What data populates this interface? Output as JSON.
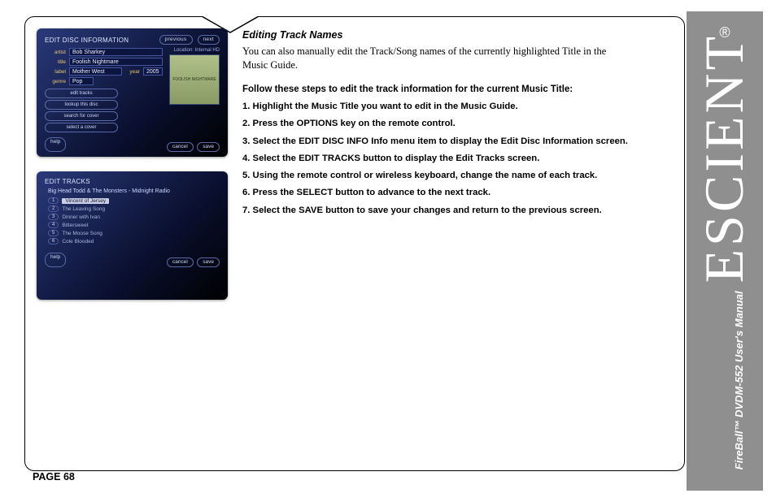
{
  "page": {
    "number_label": "PAGE 68"
  },
  "sidebar": {
    "brand": "ESCIENT",
    "registered": "®",
    "subline_product": "FireBall™",
    "subline_model": "DVDM-552 User's Manual"
  },
  "section": {
    "title": "Editing Track Names",
    "intro": "You can also manually edit the Track/Song names of the currently highlighted Title in the Music Guide.",
    "steps_lead": "Follow these steps to edit the track information for the current Music Title:",
    "steps": [
      "Highlight the Music Title you want to edit in the Music Guide.",
      "Press the OPTIONS key on the remote control.",
      "Select the EDIT DISC INFO Info menu item to display the Edit Disc Information screen.",
      "Select the EDIT TRACKS button to display the Edit Tracks screen.",
      "Using the remote control or wireless keyboard, change the name of each track.",
      "Press the SELECT button to advance to the next track.",
      "Select the SAVE button to save your changes and return to the previous screen."
    ]
  },
  "thumb1": {
    "header": "EDIT DISC INFORMATION",
    "nav_prev": "previous",
    "nav_next": "next",
    "fields": {
      "artist_label": "artist",
      "artist_value": "Bob Sharkey",
      "title_label": "title",
      "title_value": "Foolish Nightmare",
      "label_label": "label",
      "label_value": "Mother West",
      "year_label": "year",
      "year_value": "2005",
      "genre_label": "genre",
      "genre_value": "Pop"
    },
    "buttons": [
      "edit tracks",
      "lookup this disc",
      "search for cover",
      "select a cover"
    ],
    "location": "Location: Internal HD",
    "cover_text": "FOOLISH NIGHTMARE",
    "footer_help": "help",
    "footer_cancel": "cancel",
    "footer_save": "save"
  },
  "thumb2": {
    "header": "EDIT TRACKS",
    "subtitle": "Big Head Todd & The Monsters - Midnight Radio",
    "tracks": [
      {
        "n": "1",
        "name": "Vincent of Jersey",
        "current": true
      },
      {
        "n": "2",
        "name": "The Leaving Song",
        "current": false
      },
      {
        "n": "3",
        "name": "Dinner with Ivan",
        "current": false
      },
      {
        "n": "4",
        "name": "Bittersweet",
        "current": false
      },
      {
        "n": "5",
        "name": "The Moose Song",
        "current": false
      },
      {
        "n": "6",
        "name": "Cole Blooded",
        "current": false
      }
    ],
    "footer_help": "help",
    "footer_cancel": "cancel",
    "footer_save": "save"
  }
}
